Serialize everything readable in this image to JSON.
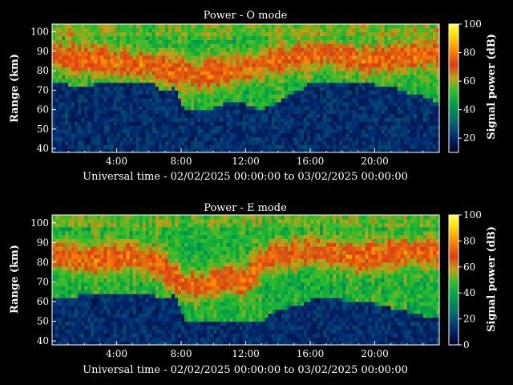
{
  "chart_data": [
    {
      "type": "heatmap",
      "title": "Power - O mode",
      "xlabel": "Universal time - 02/02/2025 00:00:00 to 03/02/2025 00:00:00",
      "ylabel": "Range (km)",
      "colorbar_label": "Signal power (dB)",
      "x_range_hours": [
        0,
        24
      ],
      "x_ticks": [
        "4:00",
        "8:00",
        "12:00",
        "16:00",
        "20:00"
      ],
      "y_range_km": [
        38,
        104
      ],
      "y_ticks": [
        "40",
        "50",
        "60",
        "70",
        "80",
        "90",
        "100"
      ],
      "color_range_db": [
        10,
        100
      ],
      "colorbar_ticks": [
        "20",
        "40",
        "60",
        "80",
        "100"
      ],
      "colormap": [
        "#000028",
        "#002a73",
        "#006f6f",
        "#00a048",
        "#2dbe2d",
        "#c3a014",
        "#dc3c14",
        "#ff8c00",
        "#ffe600",
        "#ffff5a"
      ],
      "features": {
        "echo_base_km": [
          [
            0,
            75
          ],
          [
            1,
            74
          ],
          [
            2,
            73
          ],
          [
            3,
            75
          ],
          [
            4,
            74
          ],
          [
            5,
            76
          ],
          [
            6,
            76
          ],
          [
            7,
            70
          ],
          [
            7.6,
            73
          ],
          [
            8.2,
            62
          ],
          [
            9,
            60
          ],
          [
            10,
            62
          ],
          [
            11,
            65
          ],
          [
            12,
            64
          ],
          [
            13,
            61
          ],
          [
            13.5,
            63
          ],
          [
            14.5,
            68
          ],
          [
            15.5,
            72
          ],
          [
            16,
            75
          ],
          [
            17,
            76
          ],
          [
            18,
            74
          ],
          [
            19,
            75
          ],
          [
            20,
            74
          ],
          [
            21,
            73
          ],
          [
            22,
            70
          ],
          [
            23,
            68
          ],
          [
            24,
            65
          ]
        ],
        "strong_layer_km": [
          [
            0,
            88
          ],
          [
            2,
            86
          ],
          [
            3.5,
            85
          ],
          [
            5,
            84
          ],
          [
            6.5,
            82
          ],
          [
            8,
            80
          ],
          [
            9,
            78
          ],
          [
            10,
            79
          ],
          [
            11,
            80
          ],
          [
            12,
            82
          ],
          [
            13,
            84
          ],
          [
            14,
            86
          ],
          [
            16,
            88
          ],
          [
            17,
            89
          ],
          [
            18,
            87
          ],
          [
            19,
            86
          ],
          [
            20,
            86
          ],
          [
            22,
            88
          ],
          [
            24,
            89
          ]
        ],
        "data_gaps_hours": [
          [
            7.75,
            7.88
          ]
        ]
      }
    },
    {
      "type": "heatmap",
      "title": "Power - E mode",
      "xlabel": "Universal time - 02/02/2025 00:00:00 to 03/02/2025 00:00:00",
      "ylabel": "Range (km)",
      "colorbar_label": "Signal power (dB)",
      "x_range_hours": [
        0,
        24
      ],
      "x_ticks": [
        "4:00",
        "8:00",
        "12:00",
        "16:00",
        "20:00"
      ],
      "y_range_km": [
        38,
        104
      ],
      "y_ticks": [
        "40",
        "50",
        "60",
        "70",
        "80",
        "90",
        "100"
      ],
      "color_range_db": [
        0,
        100
      ],
      "colorbar_ticks": [
        "0",
        "20",
        "40",
        "60",
        "80",
        "100"
      ],
      "colormap": [
        "#000028",
        "#002a73",
        "#006f6f",
        "#00a048",
        "#2dbe2d",
        "#c3a014",
        "#dc3c14",
        "#ff8c00",
        "#ffe600",
        "#ffff5a"
      ],
      "features": {
        "echo_base_km": [
          [
            0,
            64
          ],
          [
            1,
            63
          ],
          [
            2,
            65
          ],
          [
            3,
            64
          ],
          [
            4,
            66
          ],
          [
            5,
            65
          ],
          [
            6,
            65
          ],
          [
            7,
            62
          ],
          [
            7.6,
            66
          ],
          [
            8.2,
            52
          ],
          [
            9,
            50
          ],
          [
            10,
            51
          ],
          [
            11,
            52
          ],
          [
            12,
            51
          ],
          [
            13,
            50
          ],
          [
            13.5,
            55
          ],
          [
            14.5,
            58
          ],
          [
            15.5,
            60
          ],
          [
            16,
            62
          ],
          [
            17,
            63
          ],
          [
            18,
            62
          ],
          [
            19,
            61
          ],
          [
            20,
            60
          ],
          [
            21,
            58
          ],
          [
            22,
            56
          ],
          [
            23,
            54
          ],
          [
            24,
            52
          ]
        ],
        "strong_layer_km": [
          [
            0,
            84
          ],
          [
            2,
            82
          ],
          [
            3.5,
            82
          ],
          [
            5,
            83
          ],
          [
            6.5,
            80
          ],
          [
            8,
            70
          ],
          [
            9,
            68
          ],
          [
            10,
            70
          ],
          [
            11,
            72
          ],
          [
            12,
            70
          ],
          [
            13,
            80
          ],
          [
            14,
            84
          ],
          [
            16,
            86
          ],
          [
            17,
            85
          ],
          [
            18,
            84
          ],
          [
            19,
            83
          ],
          [
            20,
            84
          ],
          [
            22,
            85
          ],
          [
            24,
            85
          ]
        ],
        "data_gaps_hours": [
          [
            7.75,
            7.88
          ]
        ]
      }
    }
  ]
}
